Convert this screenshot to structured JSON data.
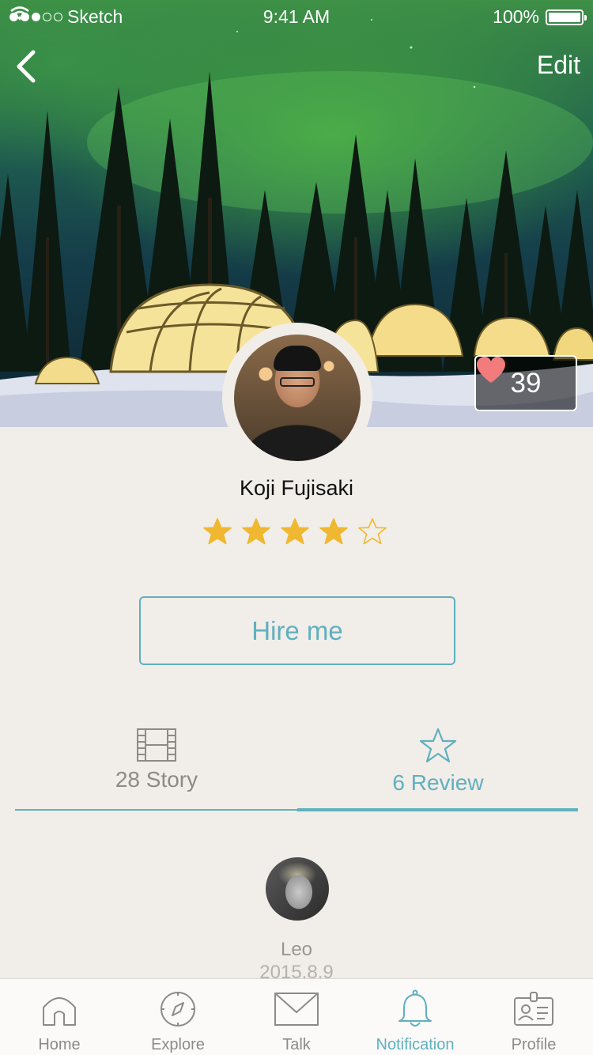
{
  "status_bar": {
    "carrier": "Sketch",
    "time": "9:41 AM",
    "battery": "100%"
  },
  "nav": {
    "back_icon": "chevron-left-icon",
    "edit_label": "Edit"
  },
  "hero": {
    "like_count": "39",
    "like_icon": "heart-icon"
  },
  "profile": {
    "name": "Koji Fujisaki",
    "rating": 4,
    "rating_max": 5
  },
  "actions": {
    "hire_label": "Hire me"
  },
  "tabs": [
    {
      "label": "28 Story",
      "icon": "film-icon",
      "active": false
    },
    {
      "label": "6 Review",
      "icon": "star-outline-icon",
      "active": true
    }
  ],
  "review": {
    "reviewer_name": "Leo",
    "date": "2015.8.9"
  },
  "tab_bar": {
    "items": [
      {
        "label": "Home",
        "icon": "home-icon",
        "active": false
      },
      {
        "label": "Explore",
        "icon": "compass-icon",
        "active": false
      },
      {
        "label": "Talk",
        "icon": "envelope-icon",
        "active": false
      },
      {
        "label": "Notification",
        "icon": "bell-icon",
        "active": true
      },
      {
        "label": "Profile",
        "icon": "id-card-icon",
        "active": false
      }
    ]
  },
  "colors": {
    "accent": "#5fb0c0",
    "star": "#f0b830",
    "background": "#f1ede8",
    "heart": "#f27c7c"
  }
}
